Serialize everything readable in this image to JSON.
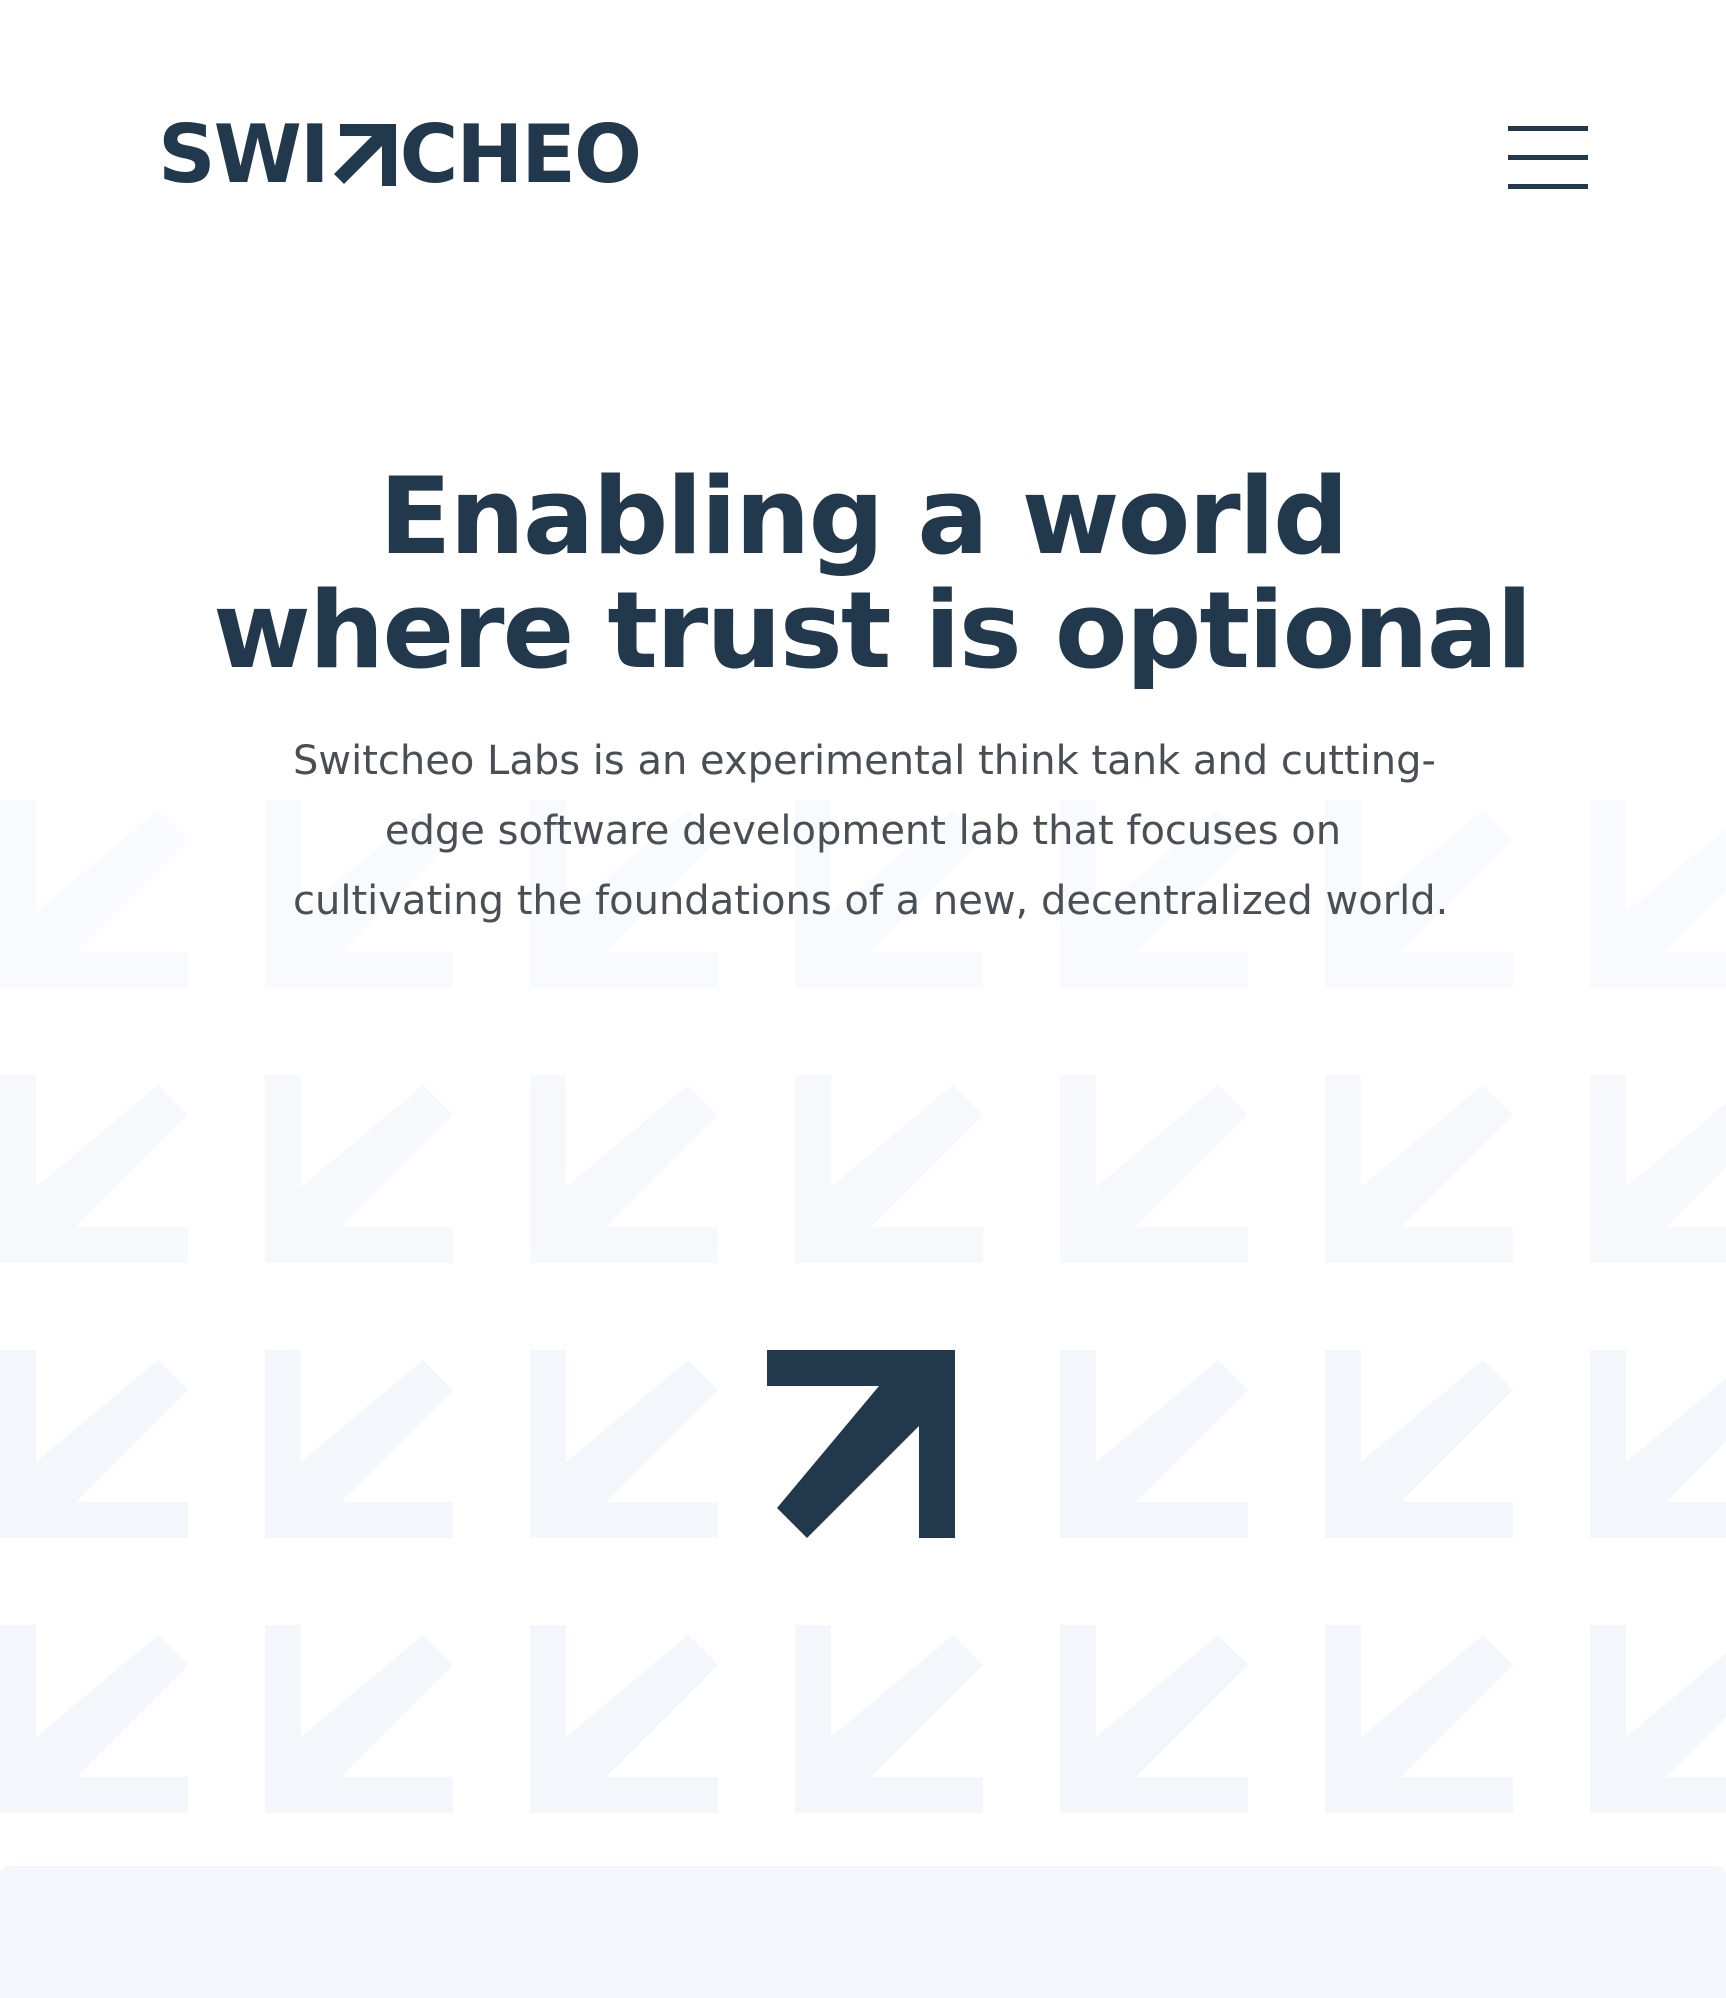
{
  "brand": {
    "name_left": "SWI",
    "name_right": "CHEO",
    "logo_icon": "switcheo-arrow-icon",
    "color": "#22384c"
  },
  "header": {
    "menu_icon": "hamburger-menu-icon"
  },
  "hero": {
    "title_lines": [
      "Enabling a world",
      "where trust is optional"
    ],
    "subtitle_lines": [
      "Switcheo Labs is an experimental think tank and cutting-",
      "edge software development lab that focuses on",
      "cultivating the foundations of a new, decentralized world."
    ],
    "title_color": "#22384c",
    "subtitle_color": "#4a4f55"
  },
  "pattern": {
    "icon": "down-left-arrow-icon",
    "featured_icon": "up-right-arrow-icon",
    "tile_color": "#f3f6fb",
    "featured_color": "#22384c"
  },
  "footer_strip": {
    "color": "#f3f6fb"
  }
}
